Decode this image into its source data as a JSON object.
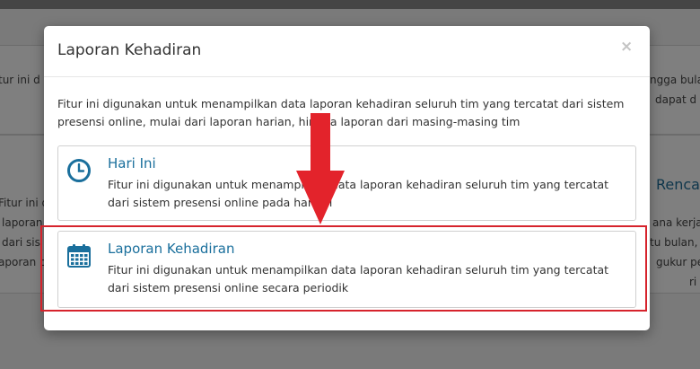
{
  "background": {
    "left_lines": [
      "tur ini d",
      "fitur ini d",
      "di s",
      "Fitur ini d",
      "laporan",
      "dari sis",
      "aporan p"
    ],
    "right_lines": [
      "ngga bulan",
      "dapat d",
      "Renca",
      "ana kerja",
      "tu bulan,",
      "gukur pe",
      "ri"
    ]
  },
  "modal": {
    "title": "Laporan Kehadiran",
    "close_label": "×",
    "description": "Fitur ini digunakan untuk menampilkan data laporan kehadiran seluruh tim yang tercatat dari sistem presensi online, mulai dari laporan harian, hingga laporan dari masing-masing tim",
    "options": [
      {
        "icon": "clock-icon",
        "title": "Hari Ini",
        "description": "Fitur ini digunakan untuk menampilkan data laporan kehadiran seluruh tim yang tercatat dari sistem presensi online pada hari ini"
      },
      {
        "icon": "calendar-icon",
        "title": "Laporan Kehadiran",
        "description": "Fitur ini digunakan untuk menampilkan data laporan kehadiran seluruh tim yang tercatat dari sistem presensi online secara periodik"
      }
    ]
  },
  "colors": {
    "accent": "#1a6f9c",
    "highlight": "#d6232c",
    "arrow": "#e3232b"
  }
}
